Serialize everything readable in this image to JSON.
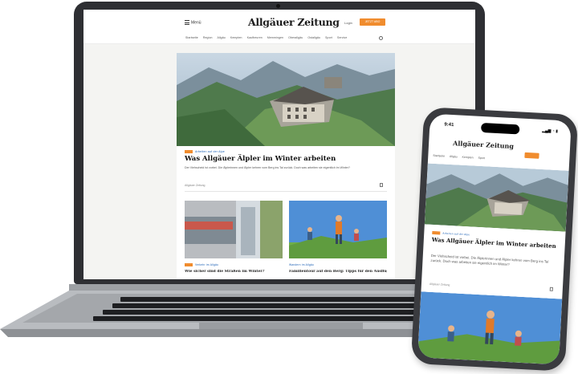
{
  "laptop": {
    "header": {
      "menu_label": "Menü",
      "logo": "Allgäuer Zeitung",
      "login_label": "Login",
      "abo_label": "JETZT ABO"
    },
    "nav_items": [
      "Startseite",
      "Region",
      "Allgäu",
      "Kempten",
      "Kaufbeuren",
      "Memmingen",
      "Oberallgäu",
      "Ostallgäu",
      "Sport",
      "Service"
    ],
    "hero": {
      "kicker": "Arbeiten auf der Alpe",
      "title": "Was Allgäuer Älpler im Winter arbeiten",
      "teaser": "Der Viehscheid ist vorbei. Die Älplerinnen und Älpler kehren vom Berg ins Tal zurück. Doch was arbeiten sie eigentlich im Winter?",
      "meta": "Allgäuer Zeitung"
    },
    "cards": [
      {
        "kicker": "Verkehr im Allgäu",
        "title": "Wie sicher sind die Straßen im Winter?"
      },
      {
        "kicker": "Wandern im Allgäu",
        "title": "Familientour auf den Berg: Tipps für den Ausflug"
      }
    ]
  },
  "phone": {
    "status_time": "9:41",
    "status_icons": "▂▄▆ ◔ ▮",
    "logo": "Allgäuer Zeitung",
    "nav_items": [
      "Startseite",
      "Allgäu",
      "Kempten",
      "Sport"
    ],
    "hero": {
      "kicker": "Arbeiten auf der Alpe",
      "title": "Was Allgäuer Älpler im Winter arbeiten",
      "teaser": "Der Viehscheid ist vorbei. Die Älplerinnen und Älpler kehren vom Berg ins Tal zurück. Doch was arbeiten sie eigentlich im Winter?",
      "meta": "Allgäuer Zeitung"
    }
  },
  "colors": {
    "accent": "#f08c2e",
    "kicker": "#1a5fb4",
    "laptop_frame": "#2e2f33",
    "phone_frame": "#3a3b3f"
  }
}
